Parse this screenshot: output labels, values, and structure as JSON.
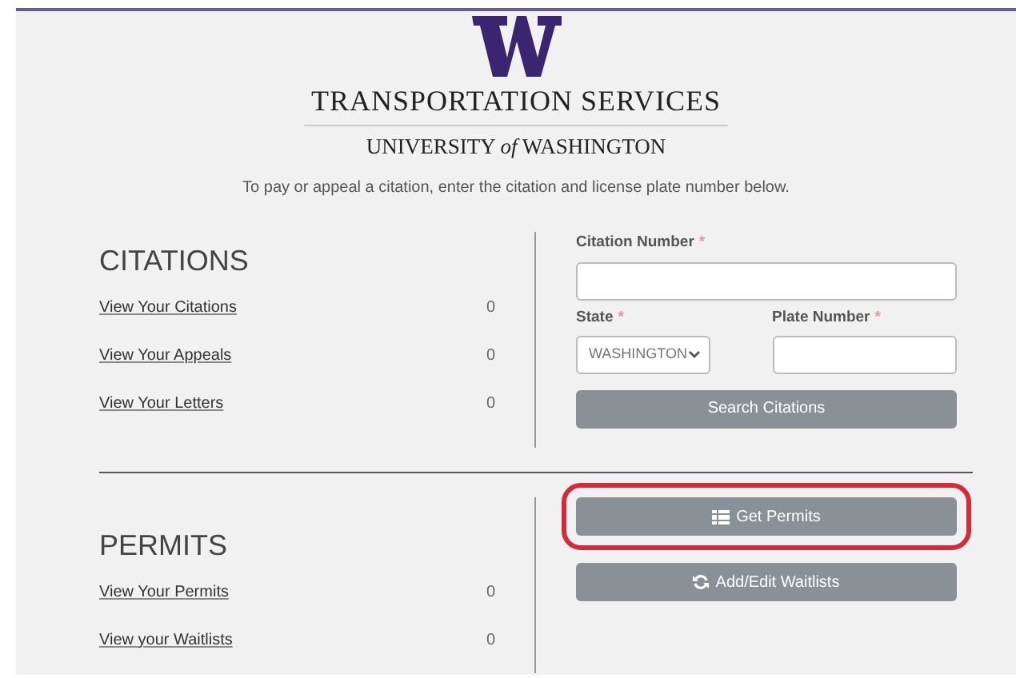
{
  "header": {
    "title": "TRANSPORTATION SERVICES",
    "subtitle": "UNIVERSITY *of* WASHINGTON",
    "instructions": "To pay or appeal a citation, enter the citation and license plate number below."
  },
  "citations": {
    "heading": "CITATIONS",
    "links": [
      {
        "label": "View Your Citations",
        "count": "0"
      },
      {
        "label": "View Your Appeals",
        "count": "0"
      },
      {
        "label": "View Your Letters",
        "count": "0"
      }
    ]
  },
  "citation_form": {
    "citation_number": {
      "label": "Citation Number",
      "required_mark": "*"
    },
    "state": {
      "label": "State",
      "required_mark": "*",
      "value": "WASHINGTON"
    },
    "plate_number": {
      "label": "Plate Number",
      "required_mark": "*"
    },
    "button": "Search Citations"
  },
  "permits": {
    "heading": "PERMITS",
    "links": [
      {
        "label": "View Your Permits",
        "count": "0"
      },
      {
        "label": "View your Waitlists",
        "count": "0"
      }
    ]
  },
  "permit_buttons": [
    {
      "label": "Get Permits",
      "kind": "list",
      "highlighted": true
    },
    {
      "label": "Add/Edit Waitlists",
      "kind": "refresh",
      "highlighted": false
    }
  ]
}
